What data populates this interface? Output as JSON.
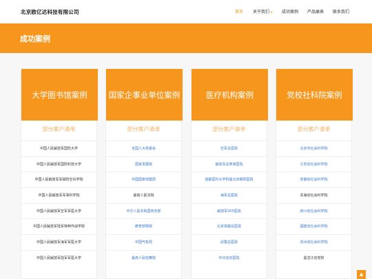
{
  "header": {
    "brand": "北京欧亿达科技有限公司",
    "nav": [
      {
        "label": "首页",
        "active": true,
        "dropdown": false
      },
      {
        "label": "关于我们",
        "active": false,
        "dropdown": true
      },
      {
        "label": "成功案例",
        "active": false,
        "dropdown": false
      },
      {
        "label": "产品展表",
        "active": false,
        "dropdown": false
      },
      {
        "label": "联系我们",
        "active": false,
        "dropdown": false
      }
    ]
  },
  "banner": {
    "title": "成功案例"
  },
  "cards": [
    {
      "title": "大学图书馆案例",
      "subtitle": "部分客户清单",
      "rows": [
        {
          "text": "中国人民解放军国防大学",
          "link": false
        },
        {
          "text": "中国人民解放军国防科技大学",
          "link": false
        },
        {
          "text": "中国人民解放军军械防空兵学院",
          "link": false
        },
        {
          "text": "中国人民解放军军事科学院",
          "link": false
        },
        {
          "text": "中国人民解放军空军军医大学",
          "link": false
        },
        {
          "text": "中国人民解放军陆军特种作战学院",
          "link": false
        },
        {
          "text": "中国人民解放军海军军医大学",
          "link": false
        },
        {
          "text": "中国人民解放军陆军军医大学",
          "link": false
        }
      ]
    },
    {
      "title": "国家企事业单位案例",
      "subtitle": "部分客户清单",
      "rows": [
        {
          "text": "全国人大常委会",
          "link": true
        },
        {
          "text": "国家发展院",
          "link": true
        },
        {
          "text": "中国国家地震局",
          "link": true
        },
        {
          "text": "最高人民法院",
          "link": false
        },
        {
          "text": "中华人民共和国商务部",
          "link": true
        },
        {
          "text": "教育部物院",
          "link": true
        },
        {
          "text": "中国气象局",
          "link": true
        },
        {
          "text": "最高人民检察院",
          "link": true
        }
      ]
    },
    {
      "title": "医疗机构案例",
      "subtitle": "部分客户清单",
      "rows": [
        {
          "text": "空军总医院",
          "link": true
        },
        {
          "text": "解放军总参谋医院",
          "link": true
        },
        {
          "text": "首都医科大学附属北京朝阳医院",
          "link": true
        },
        {
          "text": "海军总医院",
          "link": true
        },
        {
          "text": "解放军305医院",
          "link": true
        },
        {
          "text": "北京铁路总医院",
          "link": true
        },
        {
          "text": "武警总医院",
          "link": true
        },
        {
          "text": "中日友好医院",
          "link": true
        }
      ]
    },
    {
      "title": "党校社科院案例",
      "subtitle": "部分客户清单",
      "rows": [
        {
          "text": "北京市社会科学院",
          "link": true
        },
        {
          "text": "江苏省社会科学院",
          "link": true
        },
        {
          "text": "安徽省社会科学院",
          "link": true
        },
        {
          "text": "青海省社会科学院",
          "link": false
        },
        {
          "text": "四川省社会科学院",
          "link": true
        },
        {
          "text": "福建省社会科学院",
          "link": true
        },
        {
          "text": "贵州省社会科学院",
          "link": true
        },
        {
          "text": "黑龙江省党校",
          "link": false
        }
      ]
    }
  ],
  "back_to_top": {
    "icon": "arrow-up-icon",
    "glyph": "▲"
  },
  "colors": {
    "accent": "#f7961d",
    "link": "#3a78c8",
    "subtitle": "#f6b063"
  }
}
